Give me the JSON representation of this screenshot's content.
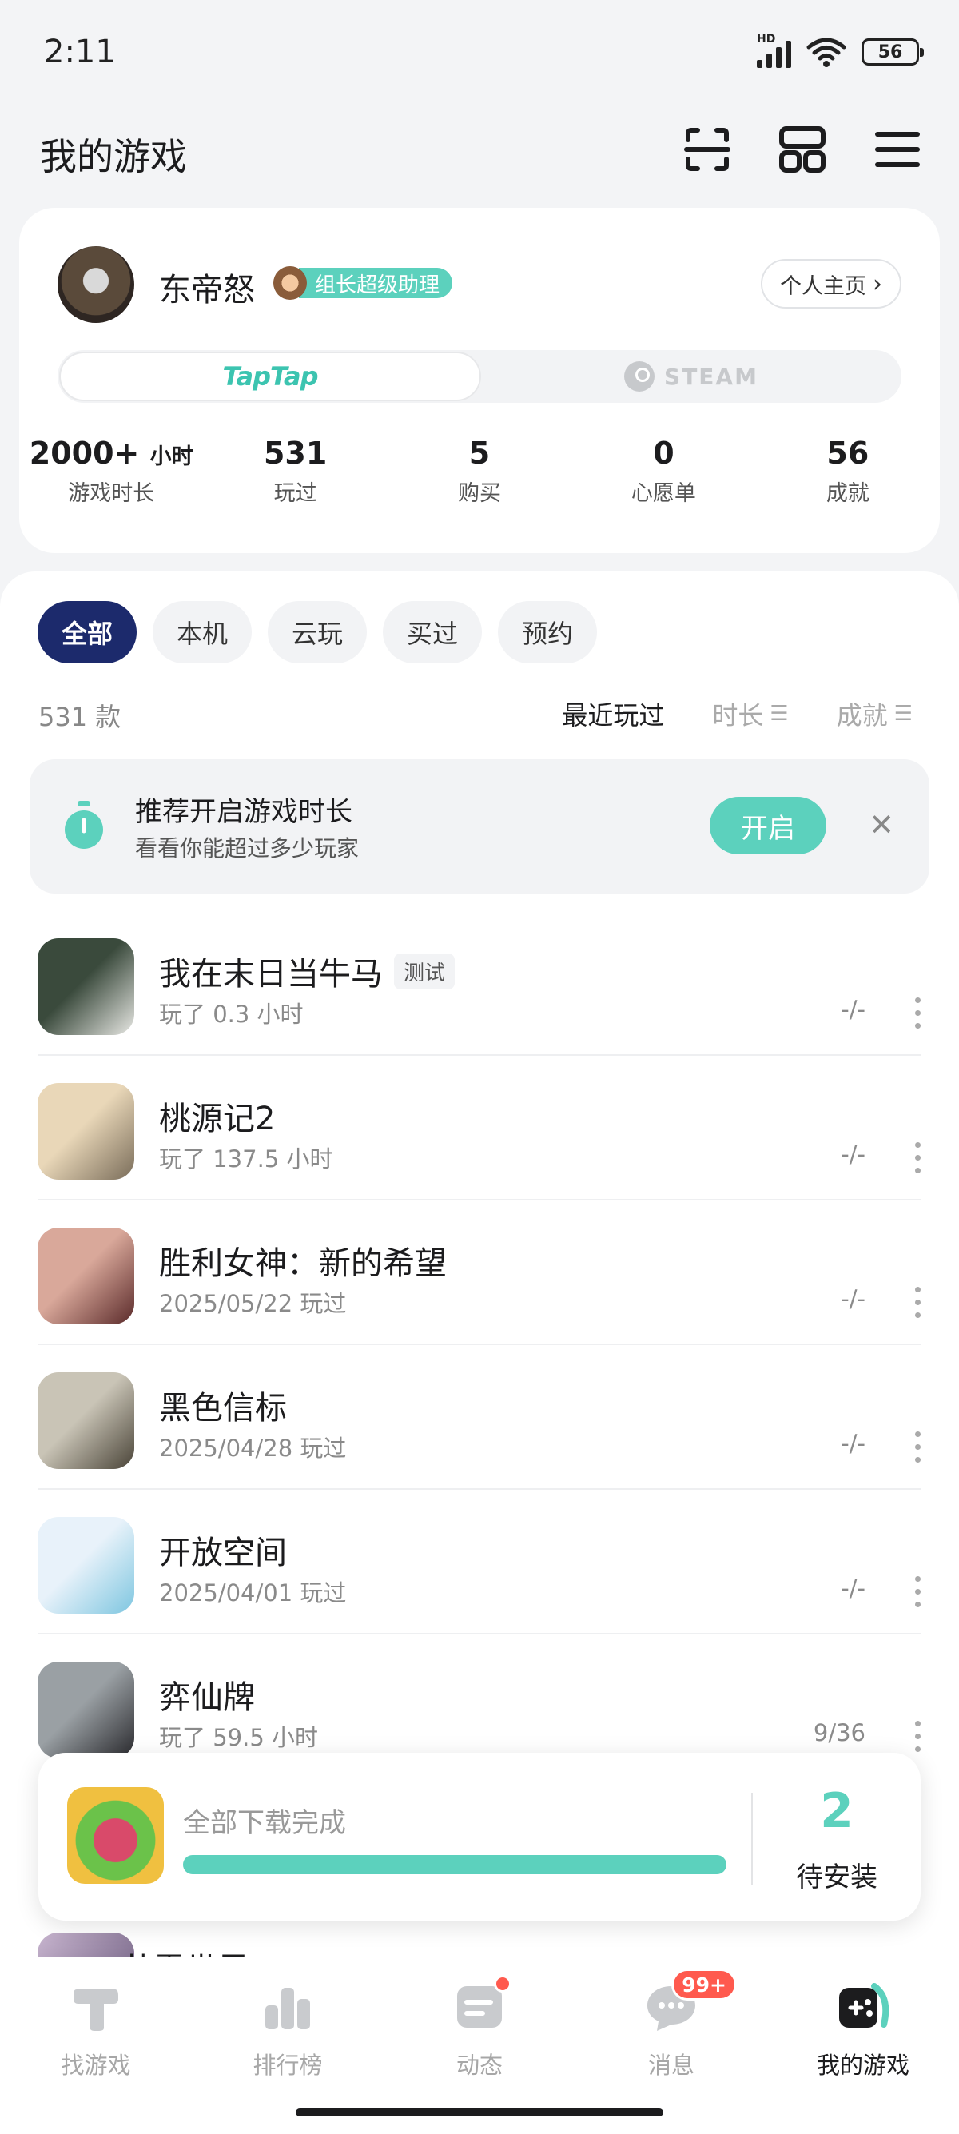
{
  "status_bar": {
    "time": "2:11",
    "network": "HD",
    "battery": "56"
  },
  "header": {
    "title": "我的游戏",
    "icons": [
      "scan-icon",
      "grid-icon",
      "menu-icon"
    ]
  },
  "profile": {
    "username": "东帝怒",
    "badge": "组长超级助理",
    "profile_link": "个人主页",
    "platforms": {
      "active": "TapTap",
      "inactive": "STEAM"
    },
    "stats": [
      {
        "value": "2000+",
        "unit": "小时",
        "label": "游戏时长"
      },
      {
        "value": "531",
        "unit": "",
        "label": "玩过"
      },
      {
        "value": "5",
        "unit": "",
        "label": "购买"
      },
      {
        "value": "0",
        "unit": "",
        "label": "心愿单"
      },
      {
        "value": "56",
        "unit": "",
        "label": "成就"
      }
    ]
  },
  "filters": [
    "全部",
    "本机",
    "云玩",
    "买过",
    "预约"
  ],
  "count": "531 款",
  "sorts": [
    "最近玩过",
    "时长",
    "成就"
  ],
  "promo": {
    "title": "推荐开启游戏时长",
    "subtitle": "看看你能超过多少玩家",
    "button": "开启"
  },
  "games": [
    {
      "name": "我在末日当牛马",
      "tag": "测试",
      "sub": "玩了 0.3 小时",
      "achievements": "-/-",
      "colors": [
        "#3a4a3c",
        "#e8e8e4"
      ]
    },
    {
      "name": "桃源记2",
      "tag": "",
      "sub": "玩了 137.5 小时",
      "achievements": "-/-",
      "colors": [
        "#e9d7b8",
        "#7a6d5a"
      ]
    },
    {
      "name": "胜利女神：新的希望",
      "tag": "",
      "sub": "2025/05/22 玩过",
      "achievements": "-/-",
      "colors": [
        "#d9a89a",
        "#5a2a2a"
      ]
    },
    {
      "name": "黑色信标",
      "tag": "",
      "sub": "2025/04/28 玩过",
      "achievements": "-/-",
      "colors": [
        "#c9c4b6",
        "#4a4438"
      ]
    },
    {
      "name": "开放空间",
      "tag": "",
      "sub": "2025/04/01 玩过",
      "achievements": "-/-",
      "colors": [
        "#e8f2fa",
        "#7ec6e0"
      ]
    },
    {
      "name": "弈仙牌",
      "tag": "",
      "sub": "玩了 59.5 小时",
      "achievements": "9/36",
      "colors": [
        "#9aa0a4",
        "#2a2a2e"
      ]
    }
  ],
  "partial_game": {
    "name": "苍雾世界"
  },
  "download": {
    "status": "全部下载完成",
    "count": "2",
    "label": "待安装",
    "progress": 1.0
  },
  "bottom_nav": [
    {
      "label": "找游戏",
      "icon": "taptap-icon"
    },
    {
      "label": "排行榜",
      "icon": "ranking-icon"
    },
    {
      "label": "动态",
      "icon": "feed-icon",
      "dot": true
    },
    {
      "label": "消息",
      "icon": "message-icon",
      "badge": "99+"
    },
    {
      "label": "我的游戏",
      "icon": "gamepad-icon",
      "active": true
    }
  ]
}
